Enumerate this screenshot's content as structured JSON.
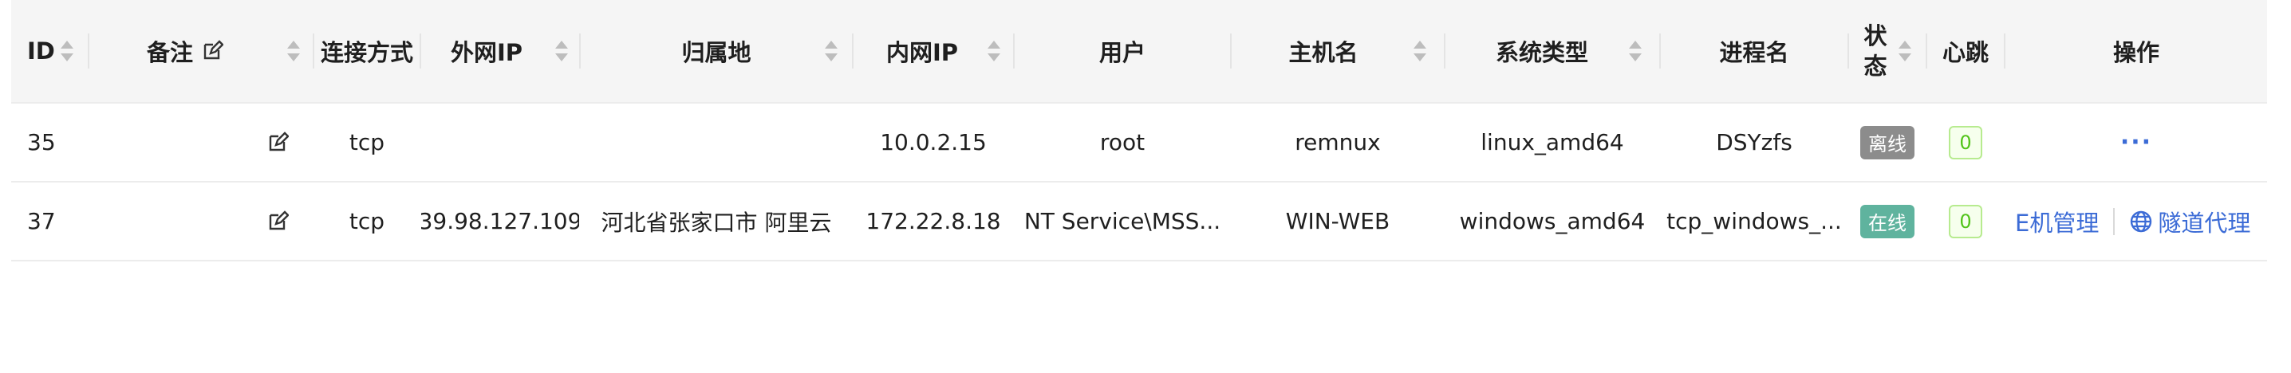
{
  "columns": {
    "id": "ID",
    "remark": "备注",
    "conn": "连接方式",
    "ext_ip": "外网IP",
    "location": "归属地",
    "int_ip": "内网IP",
    "user": "用户",
    "hostname": "主机名",
    "os": "系统类型",
    "process": "进程名",
    "status_line1": "状",
    "status_line2": "态",
    "heartbeat": "心跳",
    "actions": "操作"
  },
  "rows": [
    {
      "id": "35",
      "remark": "",
      "conn": "tcp",
      "ext_ip": "",
      "location": "",
      "int_ip": "10.0.2.15",
      "user": "root",
      "hostname": "remnux",
      "os": "linux_amd64",
      "process": "DSYzfs",
      "status": "离线",
      "heartbeat": "0",
      "more": "···"
    },
    {
      "id": "37",
      "remark": "",
      "conn": "tcp",
      "ext_ip": "39.98.127.109",
      "location": "河北省张家口市 阿里云",
      "int_ip": "172.22.8.18",
      "user": "NT Service\\MSS...",
      "hostname": "WIN-WEB",
      "os": "windows_amd64",
      "process": "tcp_windows_...",
      "status": "在线",
      "heartbeat": "0",
      "action_host": "E机管理",
      "action_tunnel": "隧道代理"
    }
  ],
  "colors": {
    "online": "#5fb39e",
    "offline": "#8c8c8c",
    "link": "#3b6bd6",
    "heartbeat": "#52c41a"
  },
  "icons": [
    "sort-icon",
    "edit-icon",
    "more-icon",
    "globe-icon"
  ]
}
